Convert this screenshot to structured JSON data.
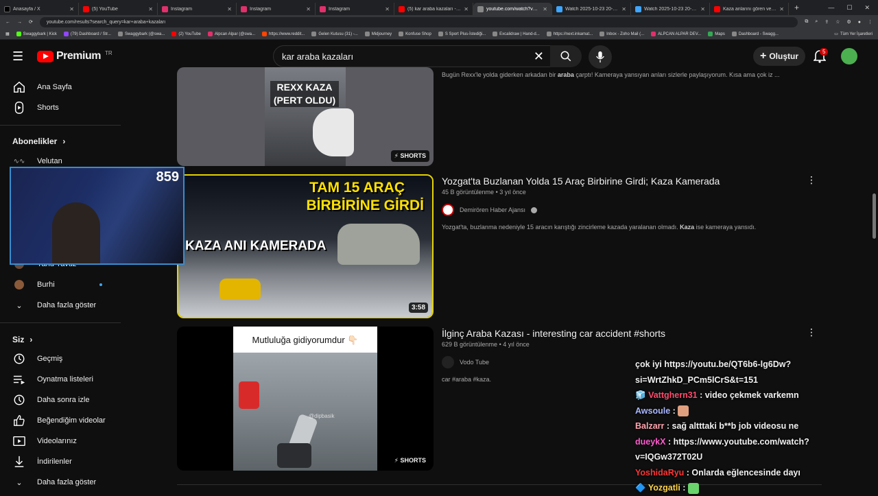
{
  "browser": {
    "tabs": [
      {
        "label": "Anasayfa / X",
        "color": "#000000"
      },
      {
        "label": "(5) YouTube",
        "color": "#ff0000"
      },
      {
        "label": "Instagram",
        "color": "#e1306c"
      },
      {
        "label": "Instagram",
        "color": "#e1306c"
      },
      {
        "label": "Instagram",
        "color": "#e1306c"
      },
      {
        "label": "(5) kar araba kazaları - Yo",
        "color": "#ff0000"
      },
      {
        "label": "youtube.com/watch?v=K3ipU",
        "color": "#888888"
      },
      {
        "label": "Watch 2025-10-23 20-01-57",
        "color": "#3ea6ff"
      },
      {
        "label": "Watch 2025-10-23 20-01-57",
        "color": "#3ea6ff"
      },
      {
        "label": "Kaza anlarını gören ve küfred",
        "color": "#ff0000"
      }
    ],
    "url": "youtube.com/results?search_query=kar+araba+kazaları",
    "bookmarks": [
      "Swaggybark | Kick",
      "(79) Dashboard / Str...",
      "Swaggybark (@swa...",
      "(2) YouTube",
      "Alpcan Alpar (@swa...",
      "https://www.reddit...",
      "Gelen Kutusu (31) -...",
      "Midjourney",
      "Konfuse Shop",
      "S Sport Plus-İstediği...",
      "Excalidraw | Hand-d...",
      "https://next.inkarnat...",
      "Inbox - Zoho Mail (...",
      "ALPCAN ALPAR DEV...",
      "Maps",
      "Dashboard - Swagg..."
    ],
    "bookmarks_all": "Tüm Yer İşaretleri"
  },
  "header": {
    "logo_text": "Premium",
    "country": "TR",
    "search_value": "kar araba kazaları",
    "create_label": "Oluştur",
    "notifications": "5"
  },
  "sidebar": {
    "home": "Ana Sayfa",
    "shorts": "Shorts",
    "subscriptions_title": "Abonelikler",
    "channels": [
      "Velutan",
      "Yahu Yavuz",
      "Burhi"
    ],
    "show_more": "Daha fazla göster",
    "you_title": "Siz",
    "you_items": [
      "Geçmiş",
      "Oynatma listeleri",
      "Daha sonra izle",
      "Beğendiğim videolar",
      "Videolarınız",
      "İndirilenler"
    ],
    "you_show_more": "Daha fazla göster"
  },
  "webcam": {
    "viewer_count": "859"
  },
  "results": [
    {
      "thumb_text": "REXX KAZA (PERT OLDU)",
      "badge": "SHORTS",
      "description_pre": "Bugün Rexx'le yolda giderken arkadan bir ",
      "description_bold": "araba",
      "description_post": " çarptı! Kameraya yansıyan anları sizlerle paylaşıyorum. Kısa ama çok iz ..."
    },
    {
      "thumb_line1": "TAM 15 ARAÇ",
      "thumb_line2": "BİRBİRİNE GİRDİ",
      "thumb_line3": "KAZA ANI KAMERADA",
      "duration": "3:58",
      "title": "Yozgat'ta Buzlanan Yolda 15 Araç Birbirine Girdi; Kaza Kamerada",
      "views": "45 B görüntülenme",
      "age": "3 yıl önce",
      "channel": "Demirören Haber Ajansı",
      "description_pre": "Yozgat'ta, buzlanma nedeniyle 15 aracın karıştığı zincirleme kazada yaralanan olmadı. ",
      "description_bold": "Kaza",
      "description_post": " ise kameraya yansıdı."
    },
    {
      "thumb_caption": "Mutluluğa gidiyorumdur 👇🏻",
      "watermark": "@dipbasik",
      "badge": "SHORTS",
      "title": "İlginç Araba Kazası - interesting car accident #shorts",
      "views": "629 B görüntülenme",
      "age": "4 yıl önce",
      "channel": "Vodo Tube",
      "description": "car #araba #kaza."
    }
  ],
  "chat": [
    {
      "user": "",
      "text": "çok iyi https://youtu.be/QT6b6-lg6Dw?si=WrtZhkD_PCm5lCrS&t=151"
    },
    {
      "user": "Vattghern31",
      "text": "video çekmek varkemn"
    },
    {
      "user": "Awsoule",
      "text": ""
    },
    {
      "user": "Balzarr",
      "text": "sağ altttaki b**b job videosu ne"
    },
    {
      "user": "dueykX",
      "text": "https://www.youtube.com/watch?v=IQGw372T02U"
    },
    {
      "user": "YoshidaRyu",
      "text": "Onlarda eğlencesinde dayı"
    },
    {
      "user": "Yozgatli",
      "text": ""
    }
  ]
}
